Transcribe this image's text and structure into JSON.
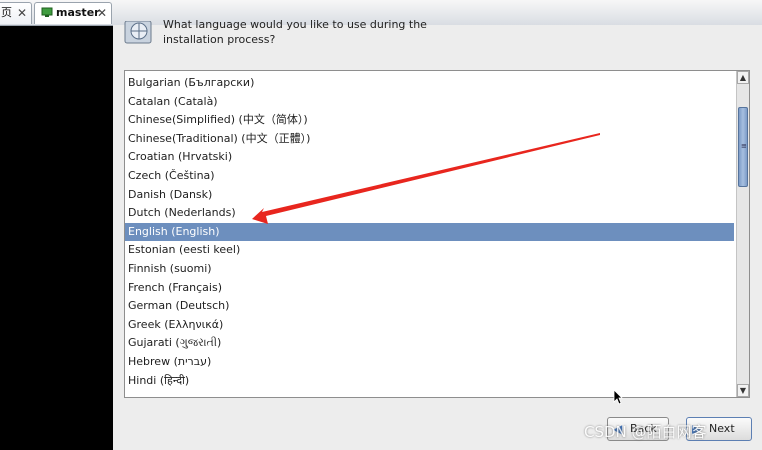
{
  "tabs": [
    {
      "label": "页",
      "active": false
    },
    {
      "label": "master",
      "active": true
    }
  ],
  "installer": {
    "prompt_line1": "What language would you like to use during the",
    "prompt_line2": "installation process?",
    "languages": [
      "Bulgarian (Български)",
      "Catalan (Català)",
      "Chinese(Simplified) (中文（简体）)",
      "Chinese(Traditional) (中文（正體）)",
      "Croatian (Hrvatski)",
      "Czech (Čeština)",
      "Danish (Dansk)",
      "Dutch (Nederlands)",
      "English (English)",
      "Estonian (eesti keel)",
      "Finnish (suomi)",
      "French (Français)",
      "German (Deutsch)",
      "Greek (Ελληνικά)",
      "Gujarati (ગુજરાતી)",
      "Hebrew (עברית)",
      "Hindi (हिन्दी)"
    ],
    "selected_index": 8,
    "back_label": "Back",
    "next_label": "Next"
  },
  "watermark": "CSDN @陌白网客",
  "colors": {
    "selection": "#6d8fbe",
    "annotation_arrow": "#e8261e",
    "background": "#ededed"
  }
}
